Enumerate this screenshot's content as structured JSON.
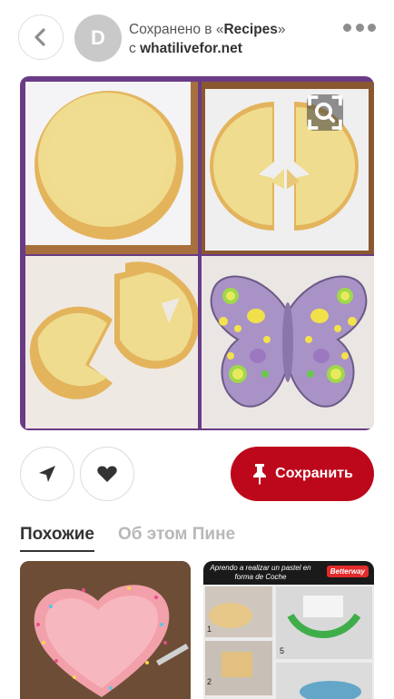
{
  "header": {
    "avatar_letter": "D",
    "saved_prefix": "Сохранено в «",
    "board_name": "Recipes",
    "saved_suffix": "»",
    "source_prefix": "с ",
    "source_domain": "whatilivefor.net"
  },
  "actions": {
    "save_label": "Сохранить"
  },
  "tabs": [
    {
      "label": "Похожие",
      "active": true
    },
    {
      "label": "Об этом Пине",
      "active": false
    }
  ],
  "related": {
    "card2_title": "Aprendo a realizar un pastel en forma de Coche",
    "card2_brand": "Betterway",
    "card2_steps": [
      "1",
      "2",
      "5"
    ]
  },
  "colors": {
    "brand_red": "#bd081c",
    "frame_purple": "#6a3b86",
    "icon_gray": "#8e8e8e"
  },
  "icons": [
    "chevron-left-icon",
    "more-dots-icon",
    "visual-search-icon",
    "send-icon",
    "heart-icon",
    "pin-icon"
  ]
}
